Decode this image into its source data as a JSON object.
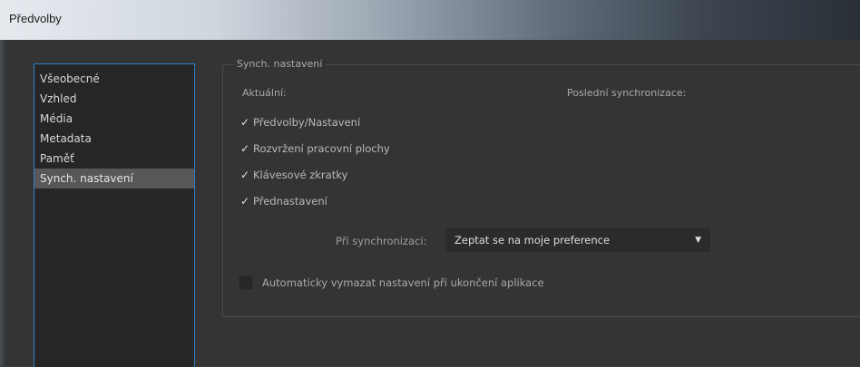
{
  "window": {
    "title": "Předvolby"
  },
  "nav": {
    "items": [
      {
        "label": "Všeobecné"
      },
      {
        "label": "Vzhled"
      },
      {
        "label": "Média"
      },
      {
        "label": "Metadata"
      },
      {
        "label": "Paměť"
      },
      {
        "label": "Synch. nastavení"
      }
    ],
    "selected": "Synch. nastavení"
  },
  "sync": {
    "group_title": "Synch. nastavení",
    "current_label": "Aktuální:",
    "last_sync_label": "Poslední synchronizace:",
    "options": [
      {
        "label": "Předvolby/Nastavení",
        "checked": true
      },
      {
        "label": "Rozvržení pracovní plochy",
        "checked": true
      },
      {
        "label": "Klávesové zkratky",
        "checked": true
      },
      {
        "label": "Přednastavení",
        "checked": true
      }
    ],
    "on_sync_label": "Při synchronizaci:",
    "on_sync_value": "Zeptat se na moje preference",
    "auto_clear_label": "Automaticky vymazat nastavení při ukončení aplikace",
    "auto_clear_checked": false
  },
  "icons": {
    "check": "checkmark-icon",
    "dropdown": "chevron-down-icon"
  },
  "colors": {
    "selection_border": "#2c82c9",
    "selected_item_bg": "#575757",
    "panel_bg": "#343434"
  }
}
